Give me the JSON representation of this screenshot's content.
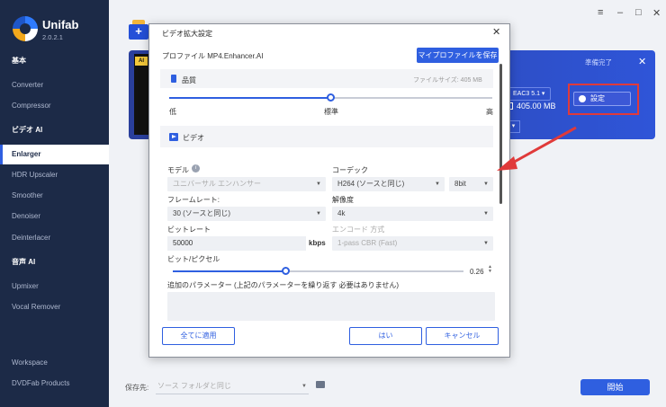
{
  "app": {
    "name": "Unifab",
    "version": "2.0.2.1"
  },
  "sidebar": {
    "sections": [
      {
        "label": "基本",
        "items": [
          "Converter",
          "Compressor"
        ]
      },
      {
        "label": "ビデオ AI",
        "items": [
          "Enlarger",
          "HDR Upscaler",
          "Smoother",
          "Denoiser",
          "Deinterlacer"
        ]
      },
      {
        "label": "音声 AI",
        "items": [
          "Upmixer",
          "Vocal Remover"
        ]
      }
    ],
    "active_item": "Enlarger",
    "bottom_items": [
      "Workspace",
      "DVDFab Products"
    ]
  },
  "window_controls": [
    "≡",
    "–",
    "□",
    "✕"
  ],
  "task": {
    "status": "準備完了",
    "audio": "EAC3 5.1",
    "size": "405.00 MB",
    "settings_label": "設定",
    "thumb_badge": "AI",
    "close": "✕"
  },
  "footer": {
    "destination_label": "保存先:",
    "destination_placeholder": "ソース フォルダと同じ",
    "start_label": "開始"
  },
  "dialog": {
    "title": "ビデオ拡大設定",
    "close": "✕",
    "profile_label": "プロファイル MP4.Enhancer.AI",
    "my_profile_button": "マイプロファイルを保存",
    "quality": {
      "label": "品質",
      "file_size": "ファイルサイズ:   405 MB",
      "level_fraction": 0.5,
      "low": "低",
      "standard": "標準",
      "high": "高"
    },
    "video": {
      "label": "ビデオ",
      "model_label": "モデル",
      "model_info": "i",
      "model_value": "ユニバーサル エンハンサー",
      "codec_label": "コーデック",
      "codec_value": "H264 (ソースと同じ)",
      "bitdepth_value": "8bit",
      "framerate_label": "フレームレート:",
      "framerate_value": "30 (ソースと同じ)",
      "resolution_label": "解像度",
      "resolution_value": "4k",
      "bitrate_label": "ビットレート",
      "bitrate_value": "50000",
      "bitrate_unit": "kbps",
      "encode_label": "エンコード 方式",
      "encode_value": "1-pass CBR (Fast)",
      "bpp_label": "ビット/ピクセル",
      "bpp_value": "0.26",
      "bpp_fraction": 0.39,
      "extra_params_label": "追加のパラメーター (上記のパラメーターを繰り返す 必要はありません)"
    },
    "buttons": {
      "apply_all": "全てに適用",
      "ok": "はい",
      "cancel": "キャンセル"
    }
  },
  "colors": {
    "sidebar_bg": "#1c2a47",
    "accent": "#2f5fe0",
    "highlight_red": "#e03a3a"
  }
}
